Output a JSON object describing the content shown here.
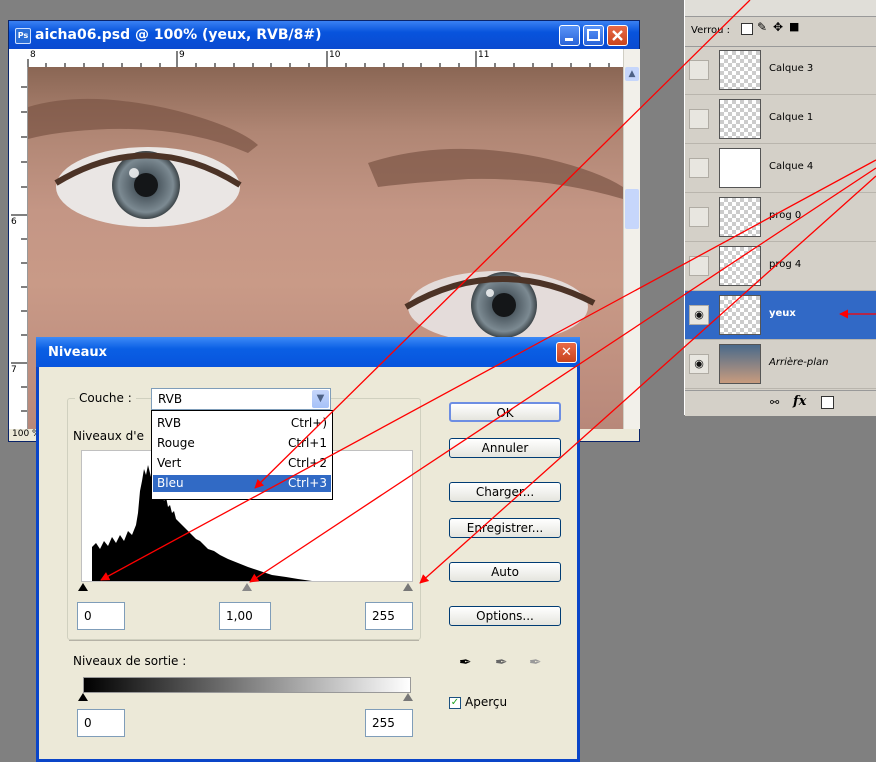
{
  "document": {
    "title": "aicha06.psd @ 100% (yeux, RVB/8#)",
    "ruler_marks": [
      "8",
      "9",
      "10",
      "11"
    ],
    "ruler_v_marks": [
      "6",
      "7"
    ],
    "status_text": "100 %"
  },
  "layers_panel": {
    "lock_label": "Verrou :",
    "layers": [
      {
        "name": "Calque 3",
        "visible": false,
        "selected": false
      },
      {
        "name": "Calque 1",
        "visible": false,
        "selected": false
      },
      {
        "name": "Calque 4",
        "visible": false,
        "selected": false
      },
      {
        "name": "prog 0",
        "visible": false,
        "selected": false
      },
      {
        "name": "prog 4",
        "visible": false,
        "selected": false
      },
      {
        "name": "yeux",
        "visible": true,
        "selected": true
      },
      {
        "name": "Arrière-plan",
        "visible": true,
        "selected": false
      }
    ],
    "footer_fx": "fx"
  },
  "levels_dialog": {
    "title": "Niveaux",
    "channel_label": "Couche :",
    "channel_value": "RVB",
    "input_levels_label": "Niveaux d'e",
    "channel_options": [
      {
        "label": "RVB",
        "shortcut": "Ctrl+)"
      },
      {
        "label": "Rouge",
        "shortcut": "Ctrl+1"
      },
      {
        "label": "Vert",
        "shortcut": "Ctrl+2"
      },
      {
        "label": "Bleu",
        "shortcut": "Ctrl+3"
      }
    ],
    "highlighted_option": "Bleu",
    "input_black": "0",
    "input_gamma": "1,00",
    "input_white": "255",
    "output_levels_label": "Niveaux de sortie :",
    "output_black": "0",
    "output_white": "255",
    "buttons": {
      "ok": "OK",
      "cancel": "Annuler",
      "load": "Charger...",
      "save": "Enregistrer...",
      "auto": "Auto",
      "options": "Options..."
    },
    "preview_label": "Aperçu",
    "preview_checked": true
  },
  "colors": {
    "titlebar_blue": "#0854dd",
    "selection_blue": "#316ac5",
    "annotation_red": "#ff0000"
  }
}
